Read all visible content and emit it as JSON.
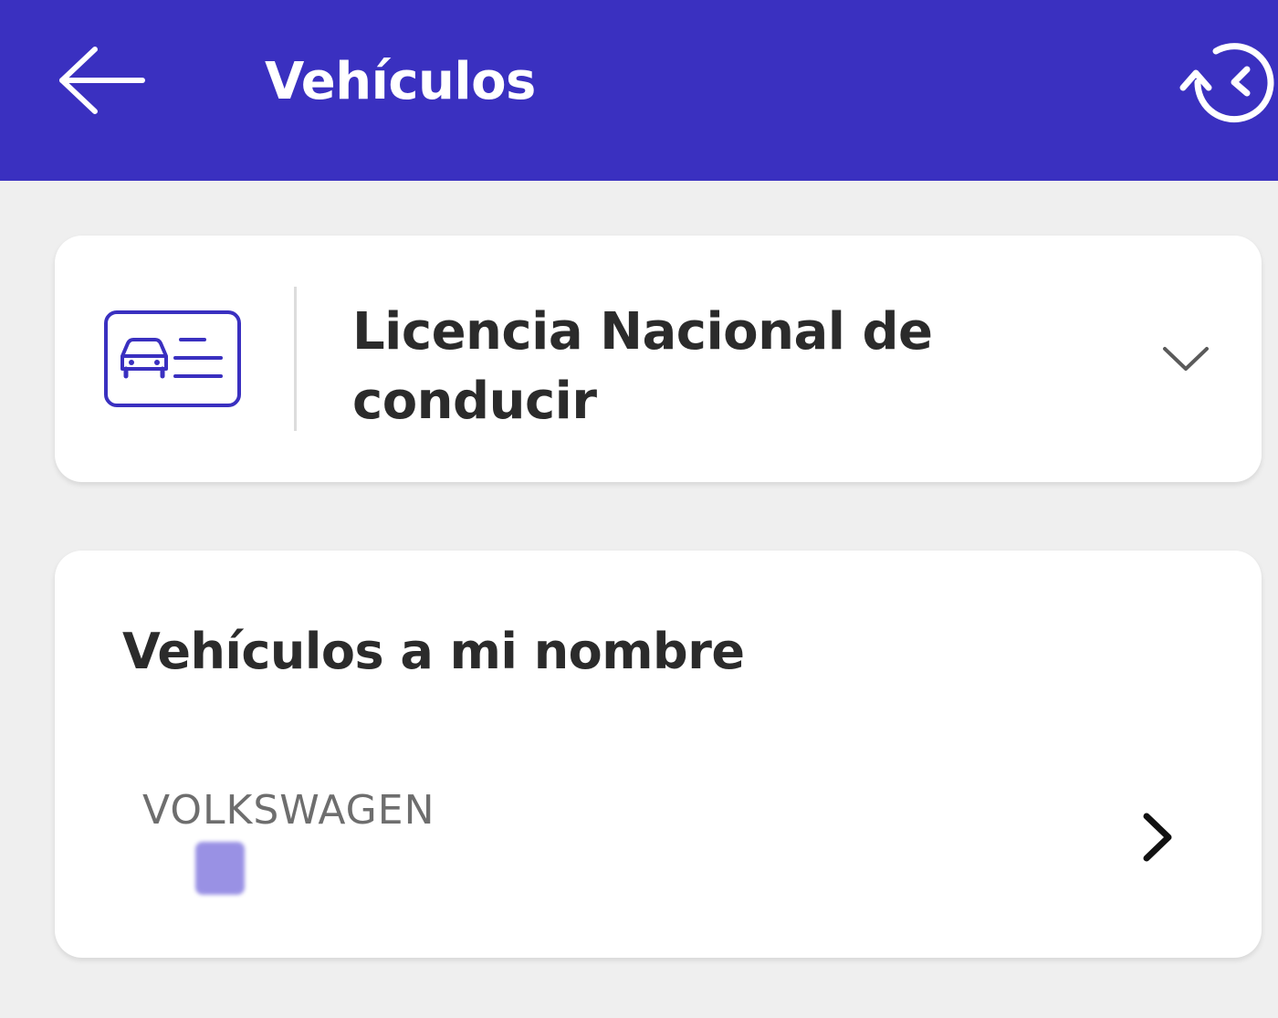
{
  "colors": {
    "appbar": "#3a30c0",
    "background": "#efefef",
    "card": "#ffffff",
    "accent": "#3a30c0",
    "text_primary": "#2b2b2b",
    "text_secondary": "#6e6e6e"
  },
  "appbar": {
    "title": "Vehículos",
    "back_icon": "arrow-left-icon",
    "history_icon": "history-icon"
  },
  "license_card": {
    "icon": "driver-license-icon",
    "title": "Licencia Nacional de conducir",
    "expand_icon": "chevron-down-icon"
  },
  "vehicles_card": {
    "title": "Vehículos a mi nombre",
    "items": [
      {
        "brand": "VOLKSWAGEN",
        "plate_redacted": true,
        "action_icon": "chevron-right-icon"
      }
    ]
  }
}
